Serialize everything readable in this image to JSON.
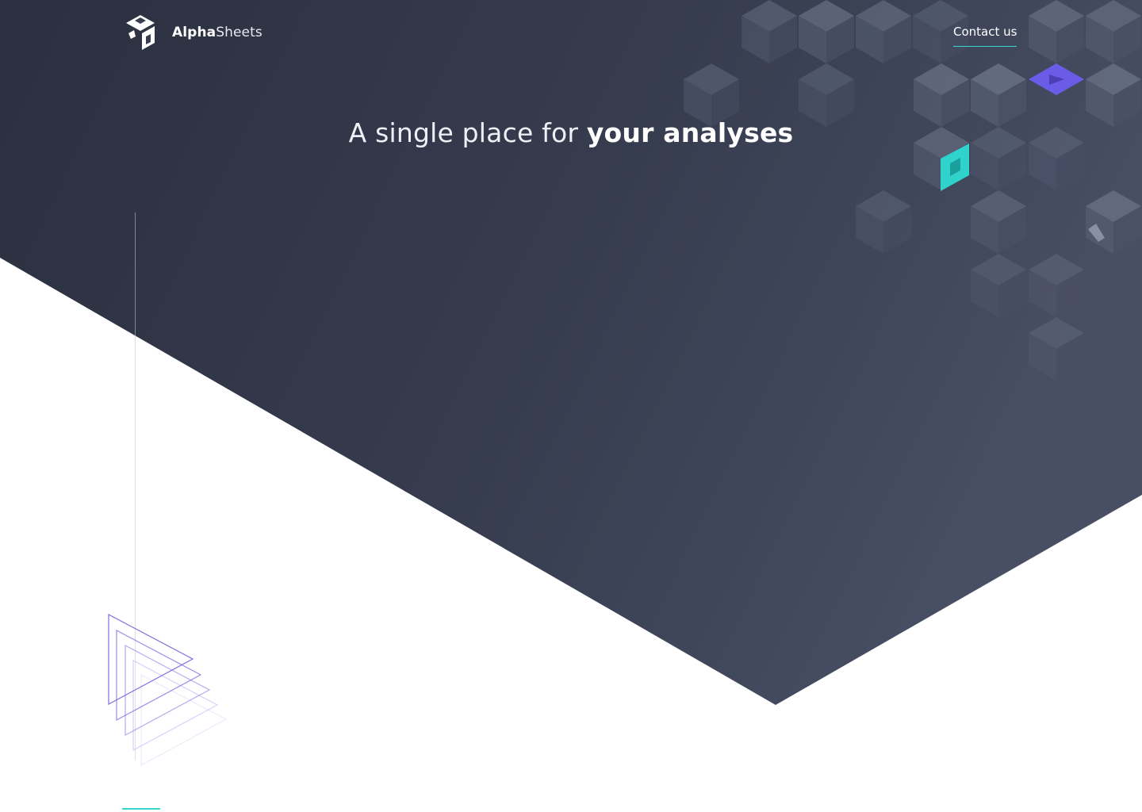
{
  "brand": {
    "name_bold": "Alpha",
    "name_light": "Sheets",
    "logo_icon": "cube-logo-icon"
  },
  "nav": {
    "contact_label": "Contact us"
  },
  "hero": {
    "headline_light": "A single place for ",
    "headline_bold": "your analyses"
  },
  "colors": {
    "hero_dark": "#2b3040",
    "hero_light": "#444a5e",
    "cube_top": "#6b7388",
    "cube_left": "#5b6278",
    "cube_right": "#4f566b",
    "accent_teal": "#35d6d0",
    "accent_purple": "#6b5ce7",
    "background": "#ffffff"
  }
}
